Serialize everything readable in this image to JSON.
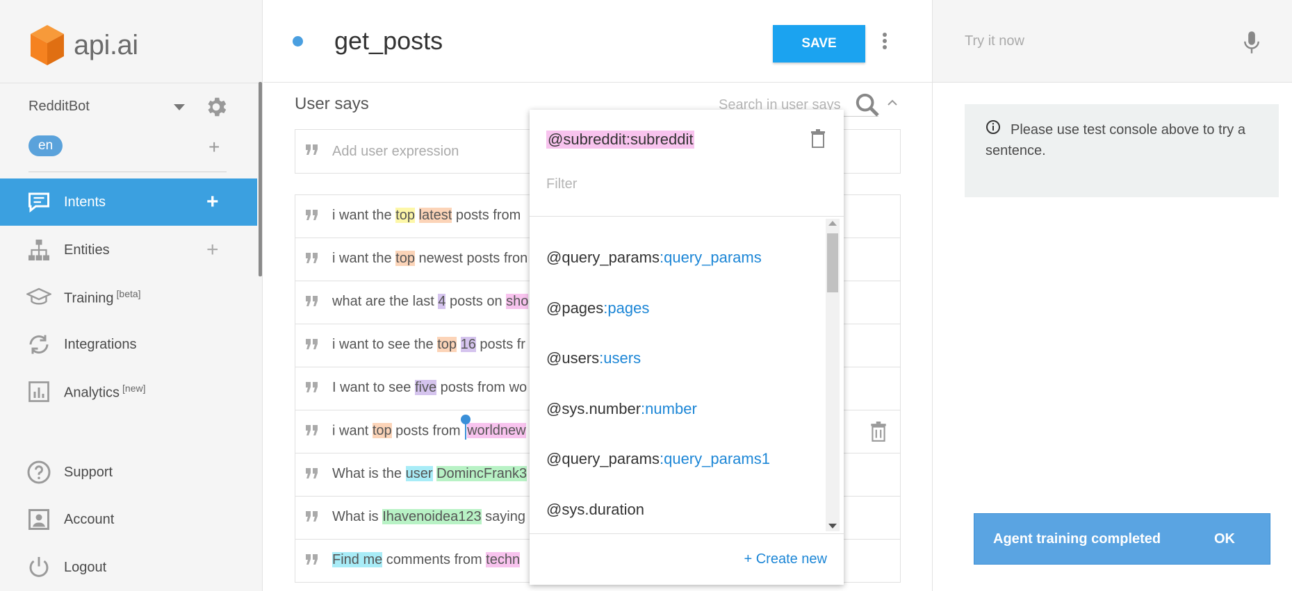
{
  "app": {
    "logo_text": "api.ai"
  },
  "agent": {
    "name": "RedditBot",
    "language": "en"
  },
  "nav": [
    {
      "label": "Intents",
      "sup": "",
      "active": true
    },
    {
      "label": "Entities",
      "sup": ""
    },
    {
      "label": "Training",
      "sup": "[beta]"
    },
    {
      "label": "Integrations",
      "sup": ""
    },
    {
      "label": "Analytics",
      "sup": "[new]"
    },
    {
      "label": "Support",
      "sup": ""
    },
    {
      "label": "Account",
      "sup": ""
    },
    {
      "label": "Logout",
      "sup": ""
    }
  ],
  "header": {
    "intent_name": "get_posts",
    "save_label": "SAVE"
  },
  "user_says": {
    "title": "User says",
    "search_placeholder": "Search in user says",
    "add_placeholder": "Add user expression",
    "expressions": [
      [
        {
          "t": "i want the "
        },
        {
          "t": "top",
          "c": "yel"
        },
        {
          "t": " "
        },
        {
          "t": "latest",
          "c": "org"
        },
        {
          "t": " posts from"
        }
      ],
      [
        {
          "t": "i want the "
        },
        {
          "t": "top",
          "c": "org"
        },
        {
          "t": " newest posts fron"
        }
      ],
      [
        {
          "t": "what are the last "
        },
        {
          "t": "4",
          "c": "pur"
        },
        {
          "t": " posts on "
        },
        {
          "t": "sho",
          "c": "pink"
        }
      ],
      [
        {
          "t": "i want to see the "
        },
        {
          "t": "top",
          "c": "org"
        },
        {
          "t": " "
        },
        {
          "t": "16",
          "c": "pur"
        },
        {
          "t": " posts fr"
        }
      ],
      [
        {
          "t": "I want to see "
        },
        {
          "t": "five",
          "c": "pur"
        },
        {
          "t": " posts from wo"
        }
      ],
      [
        {
          "t": "i want "
        },
        {
          "t": "top",
          "c": "org"
        },
        {
          "t": " posts from "
        },
        {
          "t": "|",
          "cursor": true
        },
        {
          "t": "worldnew",
          "c": "pink"
        }
      ],
      [
        {
          "t": "What is the "
        },
        {
          "t": "user",
          "c": "cyan"
        },
        {
          "t": " "
        },
        {
          "t": "DomincFrank3",
          "c": "grn"
        }
      ],
      [
        {
          "t": "What is "
        },
        {
          "t": "Ihavenoidea123",
          "c": "grn"
        },
        {
          "t": " saying"
        }
      ],
      [
        {
          "t": "Find me",
          "c": "cyan"
        },
        {
          "t": " comments from "
        },
        {
          "t": "techn",
          "c": "pink"
        }
      ]
    ]
  },
  "dropdown": {
    "selected": "@subreddit:subreddit",
    "filter_placeholder": "Filter",
    "items": [
      {
        "entity": "@query_params",
        "name": "query_params"
      },
      {
        "entity": "@pages",
        "name": "pages"
      },
      {
        "entity": "@users",
        "name": "users"
      },
      {
        "entity": "@sys.number",
        "name": "number"
      },
      {
        "entity": "@query_params",
        "name": "query_params1"
      },
      {
        "entity": "@sys.duration",
        "name": ""
      }
    ],
    "create_label": "+ Create new"
  },
  "console": {
    "placeholder": "Try it now",
    "hint": "Please use test console above to try a sentence.",
    "toast_message": "Agent training completed",
    "toast_action": "OK"
  },
  "colors": {
    "accent": "#3ba0e0",
    "save": "#1ba3f0",
    "link": "#1c86d6"
  }
}
